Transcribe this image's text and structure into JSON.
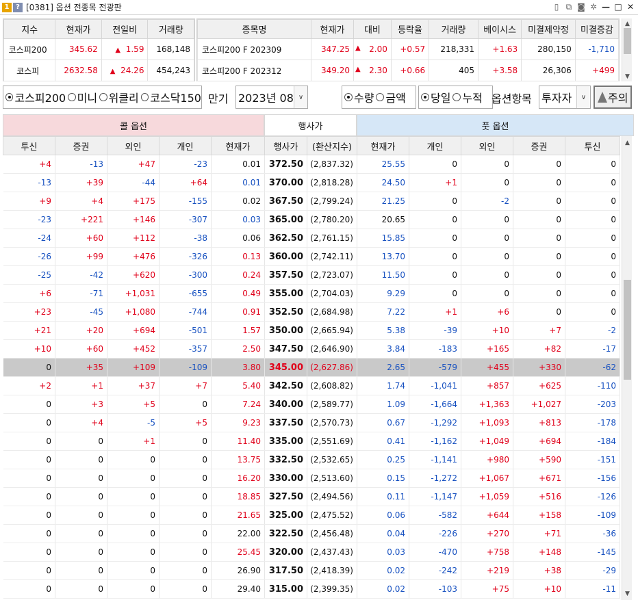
{
  "window": {
    "num_badge": "1",
    "help_badge": "?",
    "title": "[0381] 옵션 전종목 전광판"
  },
  "index_table": {
    "headers": [
      "지수",
      "현재가",
      "전일비",
      "거래량"
    ],
    "rows": [
      {
        "name": "코스피200",
        "price": "345.62",
        "arrow": "▲",
        "change": "1.59",
        "volume": "168,148"
      },
      {
        "name": "코스피",
        "price": "2632.58",
        "arrow": "▲",
        "change": "24.26",
        "volume": "454,243"
      }
    ]
  },
  "futures_table": {
    "headers": [
      "종목명",
      "현재가",
      "대비",
      "등락율",
      "거래량",
      "베이시스",
      "미결제약정",
      "미결증감"
    ],
    "rows": [
      {
        "name": "코스피200 F 202309",
        "price": "347.25",
        "arrow": "▲",
        "change": "2.00",
        "rate": "+0.57",
        "volume": "218,331",
        "basis": "+1.63",
        "oi": "280,150",
        "oi_change": "-1,710"
      },
      {
        "name": "코스피200 F 202312",
        "price": "349.20",
        "arrow": "▲",
        "change": "2.30",
        "rate": "+0.66",
        "volume": "405",
        "basis": "+3.58",
        "oi": "26,306",
        "oi_change": "+499"
      }
    ]
  },
  "controls": {
    "market_options": [
      "코스피200",
      "미니",
      "위클리",
      "코스닥150"
    ],
    "expiry_label": "만기",
    "expiry_value": "2023년 08",
    "qty_options": [
      "수량",
      "금액"
    ],
    "period_options": [
      "당일",
      "누적"
    ],
    "item_label": "옵션항목",
    "item_value": "투자자",
    "warn_label": "주의"
  },
  "grid": {
    "call_title": "콜 옵션",
    "strike_title": "행사가",
    "put_title": "풋 옵션",
    "headers": [
      "투신",
      "증권",
      "외인",
      "개인",
      "현재가",
      "행사가",
      "(환산지수)",
      "현재가",
      "개인",
      "외인",
      "증권",
      "투신"
    ],
    "rows": [
      [
        "+4",
        "-13",
        "+47",
        "-23",
        "0.01",
        "372.50",
        "(2,837.32)",
        "25.55",
        "0",
        "0",
        "0",
        "0"
      ],
      [
        "-13",
        "+39",
        "-44",
        "+64",
        "0.01",
        "370.00",
        "(2,818.28)",
        "24.50",
        "+1",
        "0",
        "0",
        "0"
      ],
      [
        "+9",
        "+4",
        "+175",
        "-155",
        "0.02",
        "367.50",
        "(2,799.24)",
        "21.25",
        "0",
        "-2",
        "0",
        "0"
      ],
      [
        "-23",
        "+221",
        "+146",
        "-307",
        "0.03",
        "365.00",
        "(2,780.20)",
        "20.65",
        "0",
        "0",
        "0",
        "0"
      ],
      [
        "-24",
        "+60",
        "+112",
        "-38",
        "0.06",
        "362.50",
        "(2,761.15)",
        "15.85",
        "0",
        "0",
        "0",
        "0"
      ],
      [
        "-26",
        "+99",
        "+476",
        "-326",
        "0.13",
        "360.00",
        "(2,742.11)",
        "13.70",
        "0",
        "0",
        "0",
        "0"
      ],
      [
        "-25",
        "-42",
        "+620",
        "-300",
        "0.24",
        "357.50",
        "(2,723.07)",
        "11.50",
        "0",
        "0",
        "0",
        "0"
      ],
      [
        "+6",
        "-71",
        "+1,031",
        "-655",
        "0.49",
        "355.00",
        "(2,704.03)",
        "9.29",
        "0",
        "0",
        "0",
        "0"
      ],
      [
        "+23",
        "-45",
        "+1,080",
        "-744",
        "0.91",
        "352.50",
        "(2,684.98)",
        "7.22",
        "+1",
        "+6",
        "0",
        "0"
      ],
      [
        "+21",
        "+20",
        "+694",
        "-501",
        "1.57",
        "350.00",
        "(2,665.94)",
        "5.38",
        "-39",
        "+10",
        "+7",
        "-2"
      ],
      [
        "+10",
        "+60",
        "+452",
        "-357",
        "2.50",
        "347.50",
        "(2,646.90)",
        "3.84",
        "-183",
        "+165",
        "+82",
        "-17"
      ],
      [
        "0",
        "+35",
        "+109",
        "-109",
        "3.80",
        "345.00",
        "(2,627.86)",
        "2.65",
        "-579",
        "+455",
        "+330",
        "-62"
      ],
      [
        "+2",
        "+1",
        "+37",
        "+7",
        "5.40",
        "342.50",
        "(2,608.82)",
        "1.74",
        "-1,041",
        "+857",
        "+625",
        "-110"
      ],
      [
        "0",
        "+3",
        "+5",
        "0",
        "7.24",
        "340.00",
        "(2,589.77)",
        "1.09",
        "-1,664",
        "+1,363",
        "+1,027",
        "-203"
      ],
      [
        "0",
        "+4",
        "-5",
        "+5",
        "9.23",
        "337.50",
        "(2,570.73)",
        "0.67",
        "-1,292",
        "+1,093",
        "+813",
        "-178"
      ],
      [
        "0",
        "0",
        "+1",
        "0",
        "11.40",
        "335.00",
        "(2,551.69)",
        "0.41",
        "-1,162",
        "+1,049",
        "+694",
        "-184"
      ],
      [
        "0",
        "0",
        "0",
        "0",
        "13.75",
        "332.50",
        "(2,532.65)",
        "0.25",
        "-1,141",
        "+980",
        "+590",
        "-151"
      ],
      [
        "0",
        "0",
        "0",
        "0",
        "16.20",
        "330.00",
        "(2,513.60)",
        "0.15",
        "-1,272",
        "+1,067",
        "+671",
        "-156"
      ],
      [
        "0",
        "0",
        "0",
        "0",
        "18.85",
        "327.50",
        "(2,494.56)",
        "0.11",
        "-1,147",
        "+1,059",
        "+516",
        "-126"
      ],
      [
        "0",
        "0",
        "0",
        "0",
        "21.65",
        "325.00",
        "(2,475.52)",
        "0.06",
        "-582",
        "+644",
        "+158",
        "-109"
      ],
      [
        "0",
        "0",
        "0",
        "0",
        "22.00",
        "322.50",
        "(2,456.48)",
        "0.04",
        "-226",
        "+270",
        "+71",
        "-36"
      ],
      [
        "0",
        "0",
        "0",
        "0",
        "25.45",
        "320.00",
        "(2,437.43)",
        "0.03",
        "-470",
        "+758",
        "+148",
        "-145"
      ],
      [
        "0",
        "0",
        "0",
        "0",
        "26.90",
        "317.50",
        "(2,418.39)",
        "0.02",
        "-242",
        "+219",
        "+38",
        "-29"
      ],
      [
        "0",
        "0",
        "0",
        "0",
        "29.40",
        "315.00",
        "(2,399.35)",
        "0.02",
        "-103",
        "+75",
        "+10",
        "-11"
      ]
    ],
    "atm_index": 11,
    "call_price_colors": [
      "blk",
      "blue",
      "blk",
      "blue",
      "blk",
      "red",
      "red",
      "red",
      "red",
      "red",
      "red",
      "red",
      "red",
      "red",
      "red",
      "red",
      "red",
      "red",
      "red",
      "red",
      "blk",
      "red",
      "blk",
      "blk"
    ],
    "put_price_colors": [
      "blue",
      "blue",
      "blue",
      "blk",
      "blue",
      "blue",
      "blue",
      "blue",
      "blue",
      "blue",
      "blue",
      "blue",
      "blue",
      "blue",
      "blue",
      "blue",
      "blue",
      "blue",
      "blue",
      "blue",
      "blue",
      "blue",
      "blue",
      "blue"
    ]
  },
  "colors": {
    "call_header_bg": "#f7d9dc",
    "put_header_bg": "#d6e7f7",
    "up": "#e0001a",
    "down": "#1650c0",
    "atm_row": "#c9c9c9"
  }
}
